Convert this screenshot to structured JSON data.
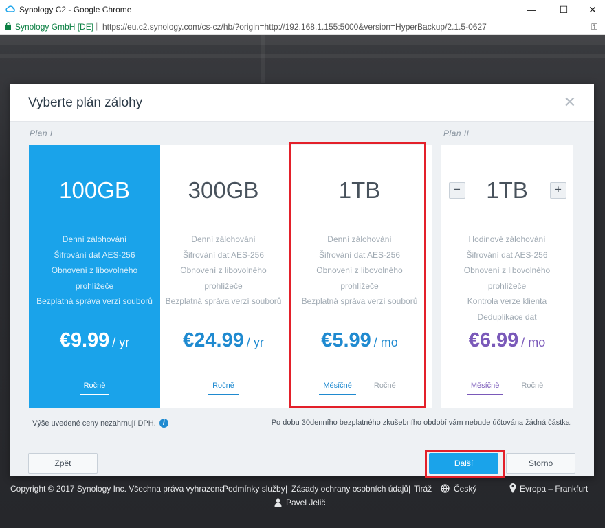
{
  "browser": {
    "title": "Synology C2 - Google Chrome",
    "site_identity": "Synology GmbH [DE]",
    "url": "https://eu.c2.synology.com/cs-cz/hb/?origin=http://192.168.1.155:5000&version=HyperBackup/2.1.5-0627",
    "buttons": {
      "minimize": "—",
      "maximize": "☐",
      "close": "✕"
    }
  },
  "modal": {
    "title": "Vyberte plán zálohy",
    "close_symbol": "✕",
    "plan1_label": "Plan I",
    "plan2_label": "Plan II",
    "plans": [
      {
        "size": "100GB",
        "features": [
          "Denní zálohování",
          "Šifrování dat AES-256",
          "Obnovení z libovolného",
          "prohlížeče",
          "Bezplatná správa verzí souborů"
        ],
        "price": "€9.99",
        "period": "/ yr",
        "tabs": [
          {
            "label": "Ročně",
            "active": true
          }
        ]
      },
      {
        "size": "300GB",
        "features": [
          "Denní zálohování",
          "Šifrování dat AES-256",
          "Obnovení z libovolného",
          "prohlížeče",
          "Bezplatná správa verzí souborů"
        ],
        "price": "€24.99",
        "period": "/ yr",
        "tabs": [
          {
            "label": "Ročně",
            "active": true
          }
        ]
      },
      {
        "size": "1TB",
        "features": [
          "Denní zálohování",
          "Šifrování dat AES-256",
          "Obnovení z libovolného",
          "prohlížeče",
          "Bezplatná správa verzí souborů"
        ],
        "price": "€5.99",
        "period": "/ mo",
        "tabs": [
          {
            "label": "Měsíčně",
            "active": true
          },
          {
            "label": "Ročně",
            "active": false
          }
        ]
      },
      {
        "size": "1TB",
        "minus": "−",
        "plus": "+",
        "features": [
          "Hodinové zálohování",
          "Šifrování dat AES-256",
          "Obnovení z libovolného",
          "prohlížeče",
          "Kontrola verze klienta",
          "Deduplikace dat"
        ],
        "price": "€6.99",
        "period": "/ mo",
        "tabs": [
          {
            "label": "Měsíčně",
            "active": true
          },
          {
            "label": "Ročně",
            "active": false
          }
        ]
      }
    ],
    "vat_note": "Výše uvedené ceny nezahrnují DPH.",
    "info_symbol": "i",
    "trial_note": "Po dobu 30denního bezplatného zkušebního období vám nebude účtována žádná částka.",
    "back_button": "Zpět",
    "next_button": "Další",
    "cancel_button": "Storno"
  },
  "page_footer": {
    "copyright": "Copyright © 2017 Synology Inc. Všechna práva vyhrazena",
    "terms": "Podmínky služby",
    "privacy": "Zásady ochrany osobních údajů",
    "imprint": "Tiráž",
    "divider": "|",
    "language": "Český",
    "region": "Evropa – Frankfurt",
    "user": "Pavel Jelič"
  },
  "colors": {
    "accent_blue": "#1aa3ea",
    "price_blue": "#1f8ad0",
    "plan2_purple": "#7a59b9",
    "annotation_red": "#e3202a"
  }
}
